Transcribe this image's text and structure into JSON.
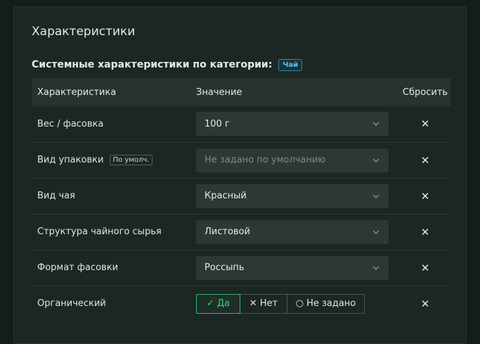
{
  "card": {
    "title": "Характеристики"
  },
  "section": {
    "subtitle": "Системные характеристики по категории:",
    "category_badge": "Чай"
  },
  "table": {
    "headers": {
      "name": "Характеристика",
      "value": "Значение",
      "reset": "Сбросить"
    },
    "rows": [
      {
        "name": "Вес / фасовка",
        "badge": "",
        "value": "100 г",
        "placeholder": false
      },
      {
        "name": "Вид упаковки",
        "badge": "По умолч.",
        "value": "Не задано по умолчанию",
        "placeholder": true
      },
      {
        "name": "Вид чая",
        "badge": "",
        "value": "Красный",
        "placeholder": false
      },
      {
        "name": "Структура чайного сырья",
        "badge": "",
        "value": "Листовой",
        "placeholder": false
      },
      {
        "name": "Формат фасовки",
        "badge": "",
        "value": "Россыпь",
        "placeholder": false
      }
    ],
    "toggle_row": {
      "name": "Органический",
      "options": [
        {
          "glyph": "✓",
          "label": "Да",
          "active": true
        },
        {
          "glyph": "✕",
          "label": "Нет",
          "active": false
        },
        {
          "glyph": "○",
          "label": "Не задано",
          "active": false
        }
      ]
    },
    "reset_glyph": "✕"
  },
  "icons": {
    "dropdown": "chevron-down-icon",
    "reset": "close-icon"
  },
  "colors": {
    "accent_green": "#3fd07a",
    "badge_blue": "#5cc5e6",
    "background": "#1c2624"
  }
}
